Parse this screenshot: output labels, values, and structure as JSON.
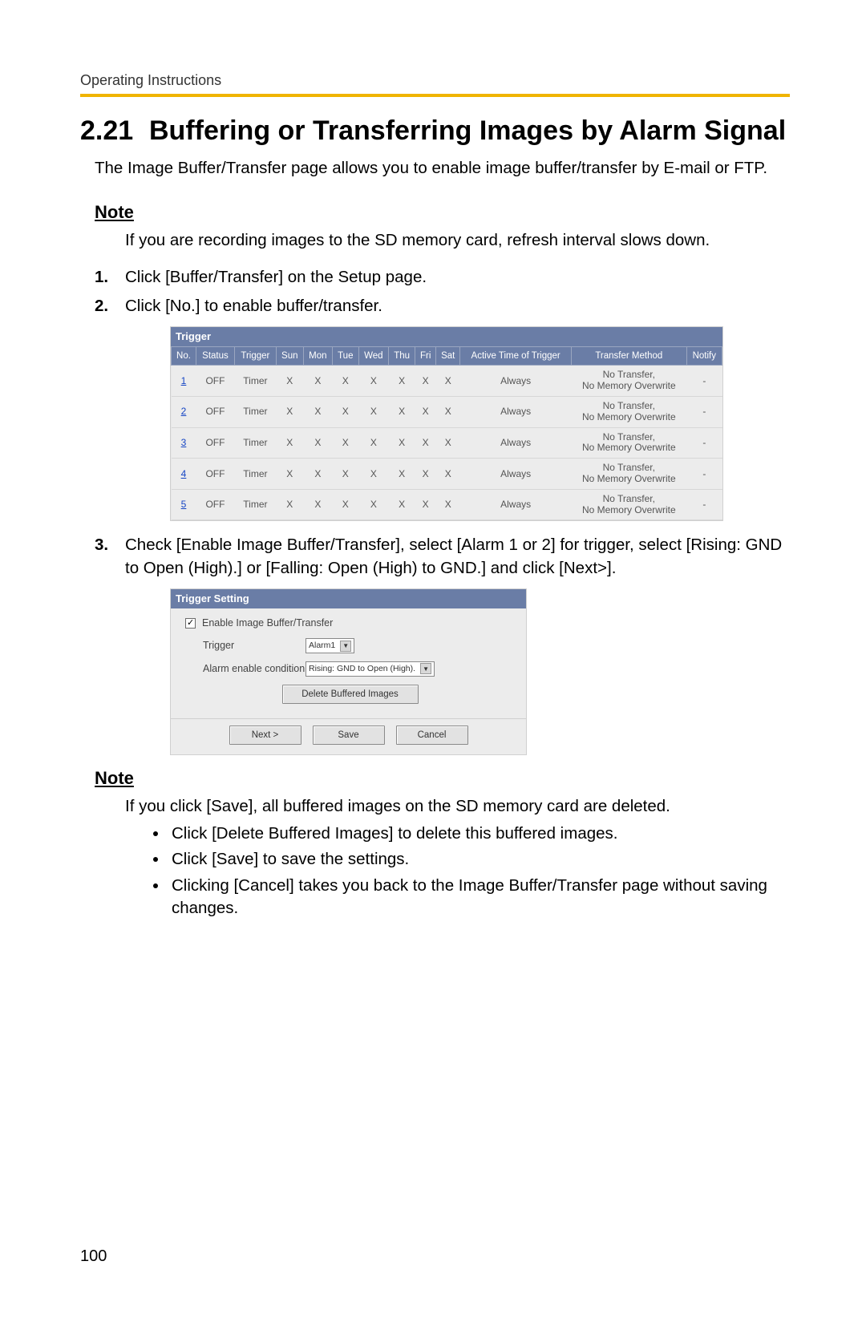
{
  "header": {
    "running": "Operating Instructions"
  },
  "section": {
    "number": "2.21",
    "title": "Buffering or Transferring Images by Alarm Signal"
  },
  "intro": "The Image Buffer/Transfer page allows you to enable image buffer/transfer by E-mail or FTP.",
  "note1": {
    "label": "Note",
    "body": "If you are recording images to the SD memory card, refresh interval slows down."
  },
  "steps": {
    "s1": "Click [Buffer/Transfer] on the Setup page.",
    "s2": "Click [No.] to enable buffer/transfer.",
    "s3": "Check [Enable Image Buffer/Transfer], select [Alarm 1 or 2] for trigger, select [Rising: GND to Open (High).] or [Falling: Open (High) to GND.] and click [Next>]."
  },
  "trigger_panel": {
    "title": "Trigger",
    "columns": {
      "no": "No.",
      "status": "Status",
      "trigger": "Trigger",
      "sun": "Sun",
      "mon": "Mon",
      "tue": "Tue",
      "wed": "Wed",
      "thu": "Thu",
      "fri": "Fri",
      "sat": "Sat",
      "active": "Active Time of Trigger",
      "method": "Transfer Method",
      "notify": "Notify"
    },
    "rows": [
      {
        "no": "1",
        "status": "OFF",
        "trigger": "Timer",
        "sun": "X",
        "mon": "X",
        "tue": "X",
        "wed": "X",
        "thu": "X",
        "fri": "X",
        "sat": "X",
        "active": "Always",
        "method": "No Transfer, No Memory Overwrite",
        "notify": "-"
      },
      {
        "no": "2",
        "status": "OFF",
        "trigger": "Timer",
        "sun": "X",
        "mon": "X",
        "tue": "X",
        "wed": "X",
        "thu": "X",
        "fri": "X",
        "sat": "X",
        "active": "Always",
        "method": "No Transfer, No Memory Overwrite",
        "notify": "-"
      },
      {
        "no": "3",
        "status": "OFF",
        "trigger": "Timer",
        "sun": "X",
        "mon": "X",
        "tue": "X",
        "wed": "X",
        "thu": "X",
        "fri": "X",
        "sat": "X",
        "active": "Always",
        "method": "No Transfer, No Memory Overwrite",
        "notify": "-"
      },
      {
        "no": "4",
        "status": "OFF",
        "trigger": "Timer",
        "sun": "X",
        "mon": "X",
        "tue": "X",
        "wed": "X",
        "thu": "X",
        "fri": "X",
        "sat": "X",
        "active": "Always",
        "method": "No Transfer, No Memory Overwrite",
        "notify": "-"
      },
      {
        "no": "5",
        "status": "OFF",
        "trigger": "Timer",
        "sun": "X",
        "mon": "X",
        "tue": "X",
        "wed": "X",
        "thu": "X",
        "fri": "X",
        "sat": "X",
        "active": "Always",
        "method": "No Transfer, No Memory Overwrite",
        "notify": "-"
      }
    ]
  },
  "setting_panel": {
    "title": "Trigger Setting",
    "enable_label": "Enable Image Buffer/Transfer",
    "trigger_label": "Trigger",
    "trigger_value": "Alarm1",
    "condition_label": "Alarm enable condition",
    "condition_value": "Rising: GND to Open (High).",
    "delete_label": "Delete Buffered Images",
    "next_label": "Next >",
    "save_label": "Save",
    "cancel_label": "Cancel"
  },
  "note2": {
    "label": "Note",
    "body": "If you click [Save], all buffered images on the SD memory card are deleted.",
    "bullets": {
      "b1": "Click [Delete Buffered Images] to delete this buffered images.",
      "b2": "Click [Save] to save the settings.",
      "b3": "Clicking [Cancel] takes you back to the Image Buffer/Transfer page without saving changes."
    }
  },
  "page_number": "100"
}
